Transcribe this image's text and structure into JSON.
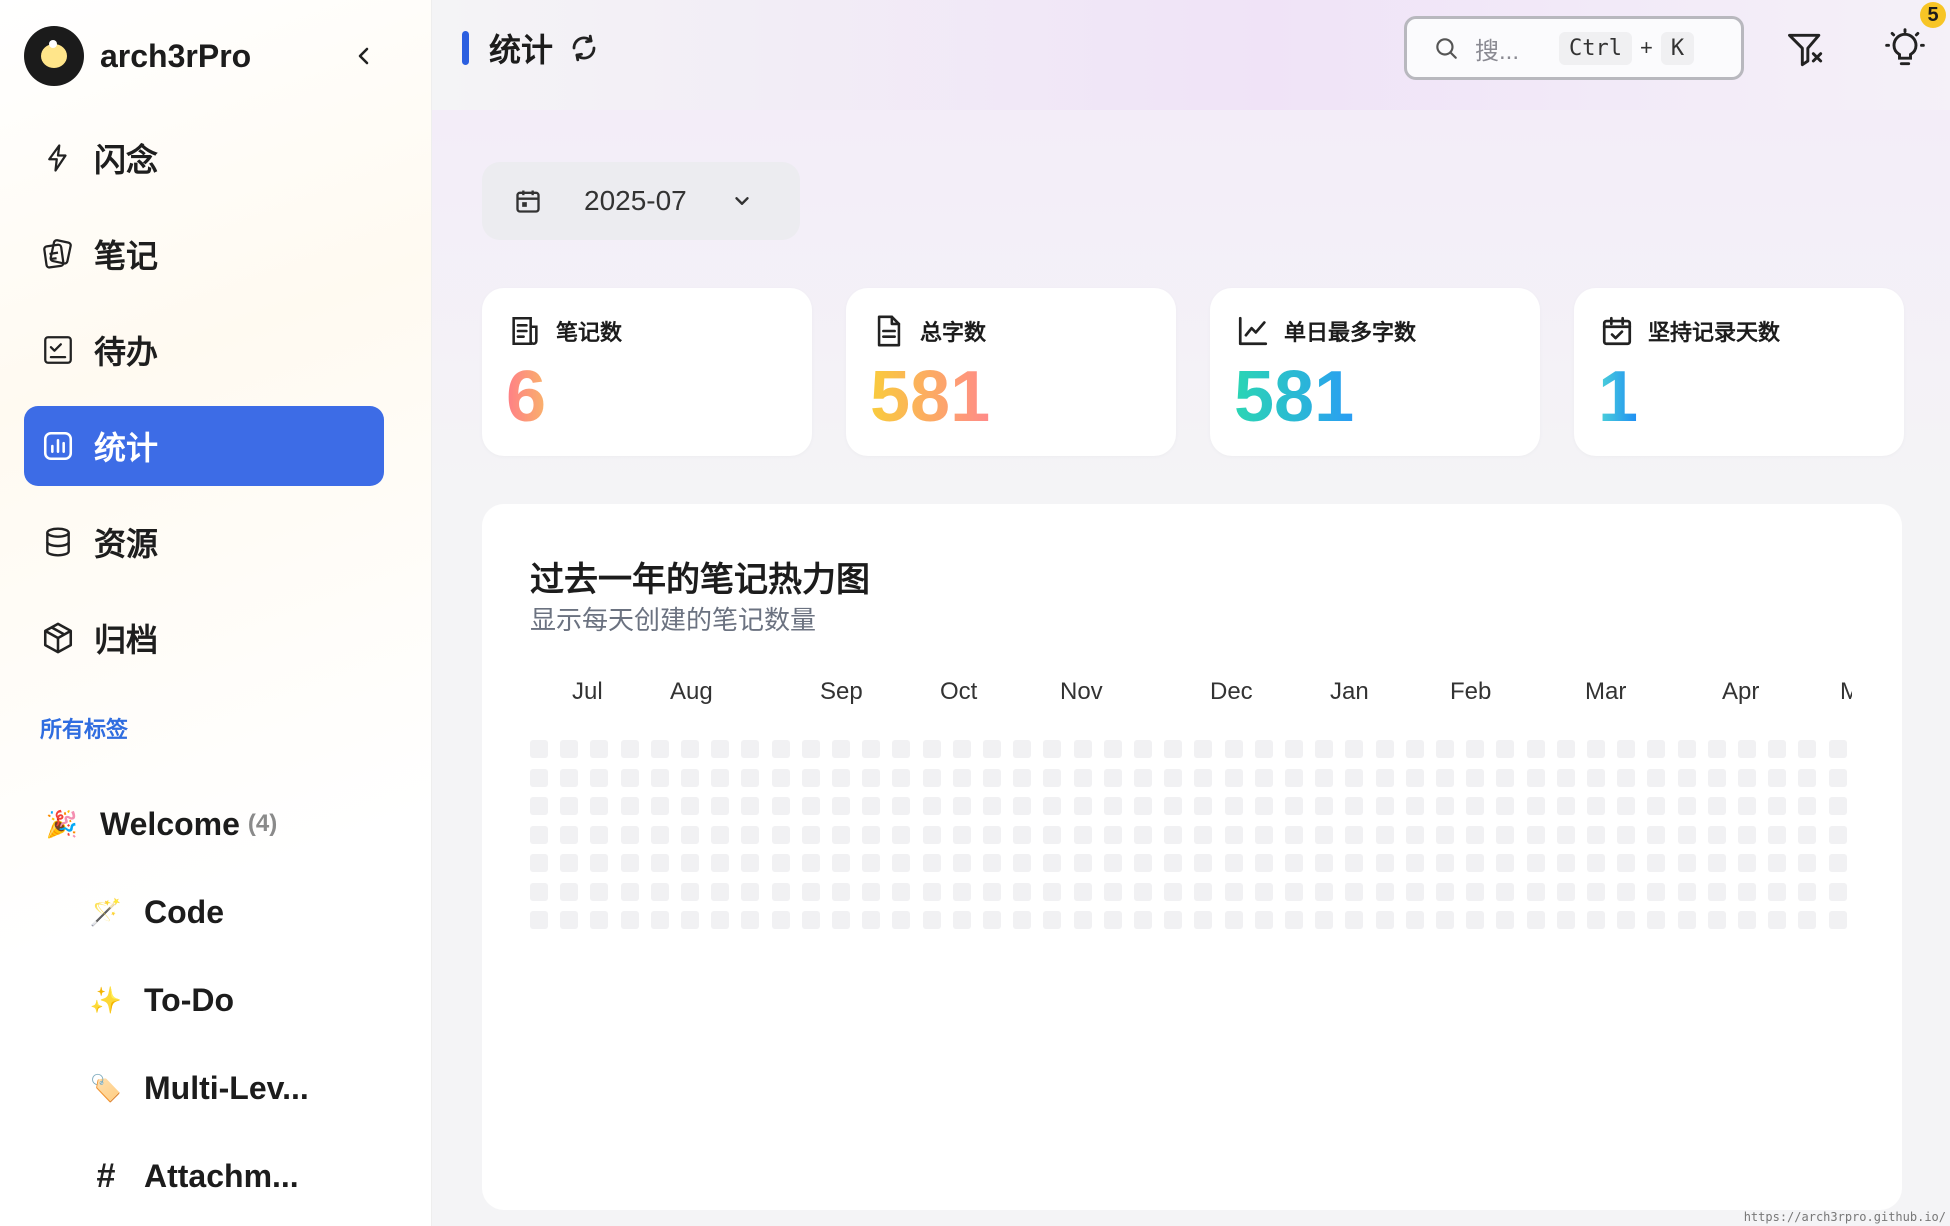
{
  "profile": {
    "name": "arch3rPro"
  },
  "nav": {
    "items": [
      {
        "label": "闪念",
        "icon": "lightning-icon"
      },
      {
        "label": "笔记",
        "icon": "notes-icon"
      },
      {
        "label": "待办",
        "icon": "checklist-icon"
      },
      {
        "label": "统计",
        "icon": "chart-icon",
        "active": true
      },
      {
        "label": "资源",
        "icon": "database-icon"
      },
      {
        "label": "归档",
        "icon": "archive-box-icon"
      }
    ]
  },
  "tags": {
    "heading": "所有标签",
    "items": [
      {
        "emoji": "🎉",
        "label": "Welcome",
        "count": "(4)"
      },
      {
        "emoji": "🪄",
        "label": "Code"
      },
      {
        "emoji": "✨",
        "label": "To-Do"
      },
      {
        "emoji": "🏷️",
        "label": "Multi-Lev..."
      },
      {
        "emoji": "#",
        "label": "Attachm..."
      }
    ]
  },
  "header": {
    "title": "统计",
    "search": {
      "placeholder": "搜...",
      "key1": "Ctrl",
      "plus": "+",
      "key2": "K"
    },
    "notification_count": "5"
  },
  "month_picker": {
    "value": "2025-07"
  },
  "stats": [
    {
      "label": "笔记数",
      "value": "6",
      "icon": "document-list-icon"
    },
    {
      "label": "总字数",
      "value": "581",
      "icon": "document-icon"
    },
    {
      "label": "单日最多字数",
      "value": "581",
      "icon": "line-chart-icon"
    },
    {
      "label": "坚持记录天数",
      "value": "1",
      "icon": "calendar-check-icon"
    }
  ],
  "heatmap": {
    "title": "过去一年的笔记热力图",
    "subtitle": "显示每天创建的笔记数量",
    "months": [
      "Jul",
      "Aug",
      "Sep",
      "Oct",
      "Nov",
      "Dec",
      "Jan",
      "Feb",
      "Mar",
      "Apr",
      "May"
    ],
    "weeks": 44,
    "days_per_week": 7
  },
  "footer": {
    "url": "https://arch3rpro.github.io/"
  }
}
